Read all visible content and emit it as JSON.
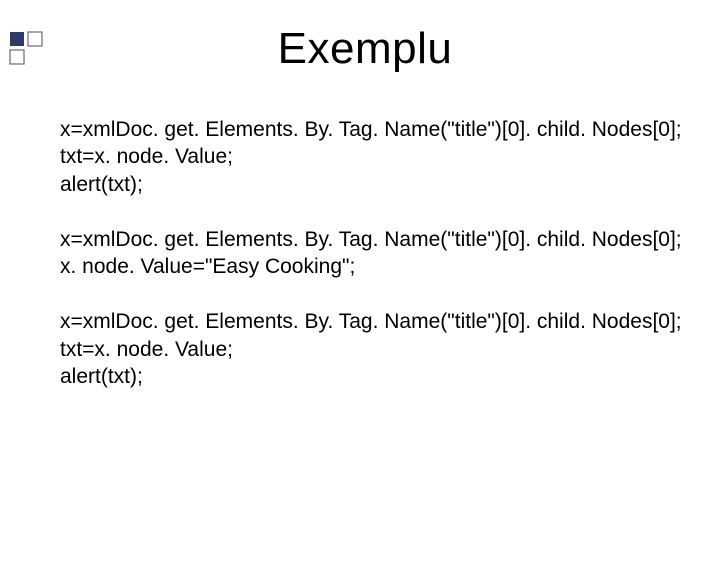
{
  "title": "Exemplu",
  "blocks": [
    {
      "lines": [
        "x=xmlDoc. get. Elements. By. Tag. Name(\"title\")[0]. child. Nodes[0];",
        "txt=x. node. Value;",
        "alert(txt);"
      ]
    },
    {
      "lines": [
        "x=xmlDoc. get. Elements. By. Tag. Name(\"title\")[0]. child. Nodes[0];",
        "x. node. Value=\"Easy Cooking\";"
      ]
    },
    {
      "lines": [
        "x=xmlDoc. get. Elements. By. Tag. Name(\"title\")[0]. child. Nodes[0];",
        "txt=x. node. Value;",
        "alert(txt);"
      ]
    }
  ]
}
